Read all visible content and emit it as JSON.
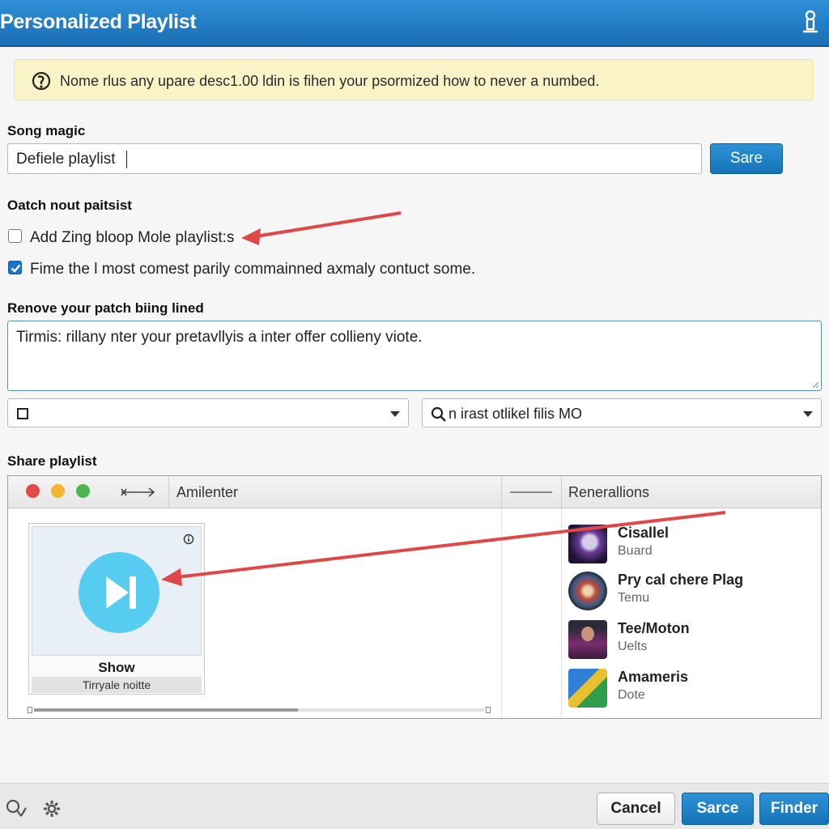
{
  "window": {
    "title": "Personalized Playlist",
    "user_icon": "user-icon"
  },
  "notice": {
    "icon": "info-icon",
    "text": "Nome rlus any upare desc1.00 ldin is fihen your psormized how to never a numbed."
  },
  "song_magic": {
    "label": "Song magic",
    "value": "Defiele playlist",
    "save_button": "Sare"
  },
  "options": {
    "label": "Oatch nout paitsist",
    "items": [
      {
        "label": "Add Zing bloop Mole playlist:s",
        "checked": false
      },
      {
        "label": "Fime the l most comest parily commainned axmaly contuct some.",
        "checked": true
      }
    ]
  },
  "remove": {
    "label": "Renove your patch biing lined",
    "text": "Tirmis: rillany nter your pretavllyis a inter offer collieny viote."
  },
  "selects": {
    "left_value": "",
    "right_value": "n irast otlikel filis MO"
  },
  "share": {
    "label": "Share playlist",
    "header_col1": "Amilenter",
    "header_col2": "Renerallions",
    "card": {
      "title": "Show",
      "subtitle": "Tirryale noitte"
    },
    "recommendations": [
      {
        "title": "Cisallel",
        "subtitle": "Buard"
      },
      {
        "title": "Pry cal chere Plag",
        "subtitle": "Temu"
      },
      {
        "title": "Tee/Moton",
        "subtitle": "Uelts"
      },
      {
        "title": "Amameris",
        "subtitle": "Dote"
      }
    ]
  },
  "footer": {
    "cancel": "Cancel",
    "sarce": "Sarce",
    "finder": "Finder"
  },
  "colors": {
    "accent": "#1a6fb5",
    "arrow": "#e04848",
    "notice_bg": "#fbf3c8"
  }
}
